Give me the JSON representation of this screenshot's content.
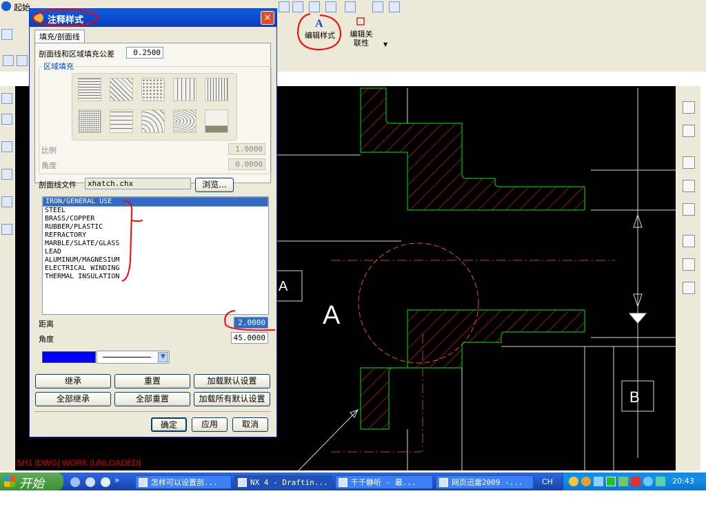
{
  "toolbar": {
    "start_menu_label": "起始",
    "edit_style_label": "编辑样式",
    "edit_associativity_label": "编辑关联性"
  },
  "dialog": {
    "title": "注释样式",
    "tab_label": "填充/剖面线",
    "tolerance_label": "剖面线和区域填充公差",
    "tolerance_value": "0.2500",
    "area_fill_group": "区域填充",
    "scale_label": "比例",
    "scale_value": "1.0000",
    "angle_fill_label": "角度",
    "angle_fill_value": "0.0000",
    "hatch_file_label": "剖面线文件",
    "hatch_file_value": "xhatch.chx",
    "browse_label": "浏览...",
    "hatch_list": [
      "IRON/GENERAL USE",
      "STEEL",
      "BRASS/COPPER",
      "RUBBER/PLASTIC",
      "REFRACTORY",
      "MARBLE/SLATE/GLASS",
      "LEAD",
      "ALUMINUM/MAGNESIUM",
      "ELECTRICAL WINDING",
      "THERMAL INSULATION"
    ],
    "distance_label": "距离",
    "distance_value": "2.0000",
    "angle_label": "角度",
    "angle_value": "45.0000",
    "color": "#0000ff",
    "buttons": {
      "inherit": "继承",
      "reset": "重置",
      "load_default": "加载默认设置",
      "inherit_all": "全部继承",
      "reset_all": "全部重置",
      "load_all_default": "加载所有默认设置",
      "ok": "确定",
      "apply": "应用",
      "cancel": "取消"
    }
  },
  "drawing": {
    "section_label_a": "A",
    "view_label_a": "A",
    "view_label_b": "B",
    "status_text": "SH1 [DWG] WORK [UNLOADED]"
  },
  "taskbar": {
    "start_label": "开始",
    "tasks": [
      "怎样可以设置剖...",
      "NX 4 - Draftin...",
      "千千静听 - 最...",
      "网页迅雷2009 -..."
    ],
    "language": "CH",
    "clock": "20:43"
  },
  "colors": {
    "hatch": "#ff2020",
    "outline": "#00c000",
    "annotation_circle": "#e00000",
    "selection": "#316ac5"
  }
}
